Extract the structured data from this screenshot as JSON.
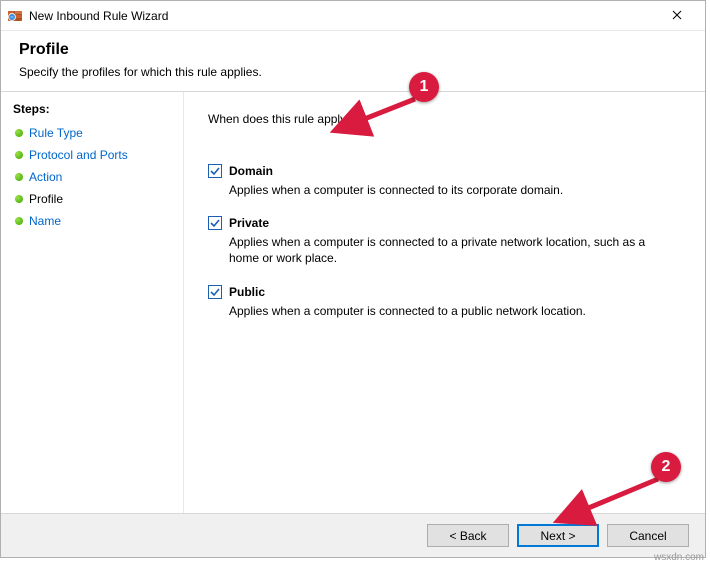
{
  "window": {
    "title": "New Inbound Rule Wizard"
  },
  "header": {
    "title": "Profile",
    "subtitle": "Specify the profiles for which this rule applies."
  },
  "steps": {
    "label": "Steps:",
    "items": [
      {
        "label": "Rule Type",
        "current": false
      },
      {
        "label": "Protocol and Ports",
        "current": false
      },
      {
        "label": "Action",
        "current": false
      },
      {
        "label": "Profile",
        "current": true
      },
      {
        "label": "Name",
        "current": false
      }
    ]
  },
  "content": {
    "question": "When does this rule apply?",
    "options": [
      {
        "label": "Domain",
        "checked": true,
        "desc": "Applies when a computer is connected to its corporate domain."
      },
      {
        "label": "Private",
        "checked": true,
        "desc": "Applies when a computer is connected to a private network location, such as a home or work place."
      },
      {
        "label": "Public",
        "checked": true,
        "desc": "Applies when a computer is connected to a public network location."
      }
    ]
  },
  "footer": {
    "back": "< Back",
    "next": "Next >",
    "cancel": "Cancel"
  },
  "annotations": {
    "badge1": "1",
    "badge2": "2"
  },
  "watermark": "wsxdn.com"
}
